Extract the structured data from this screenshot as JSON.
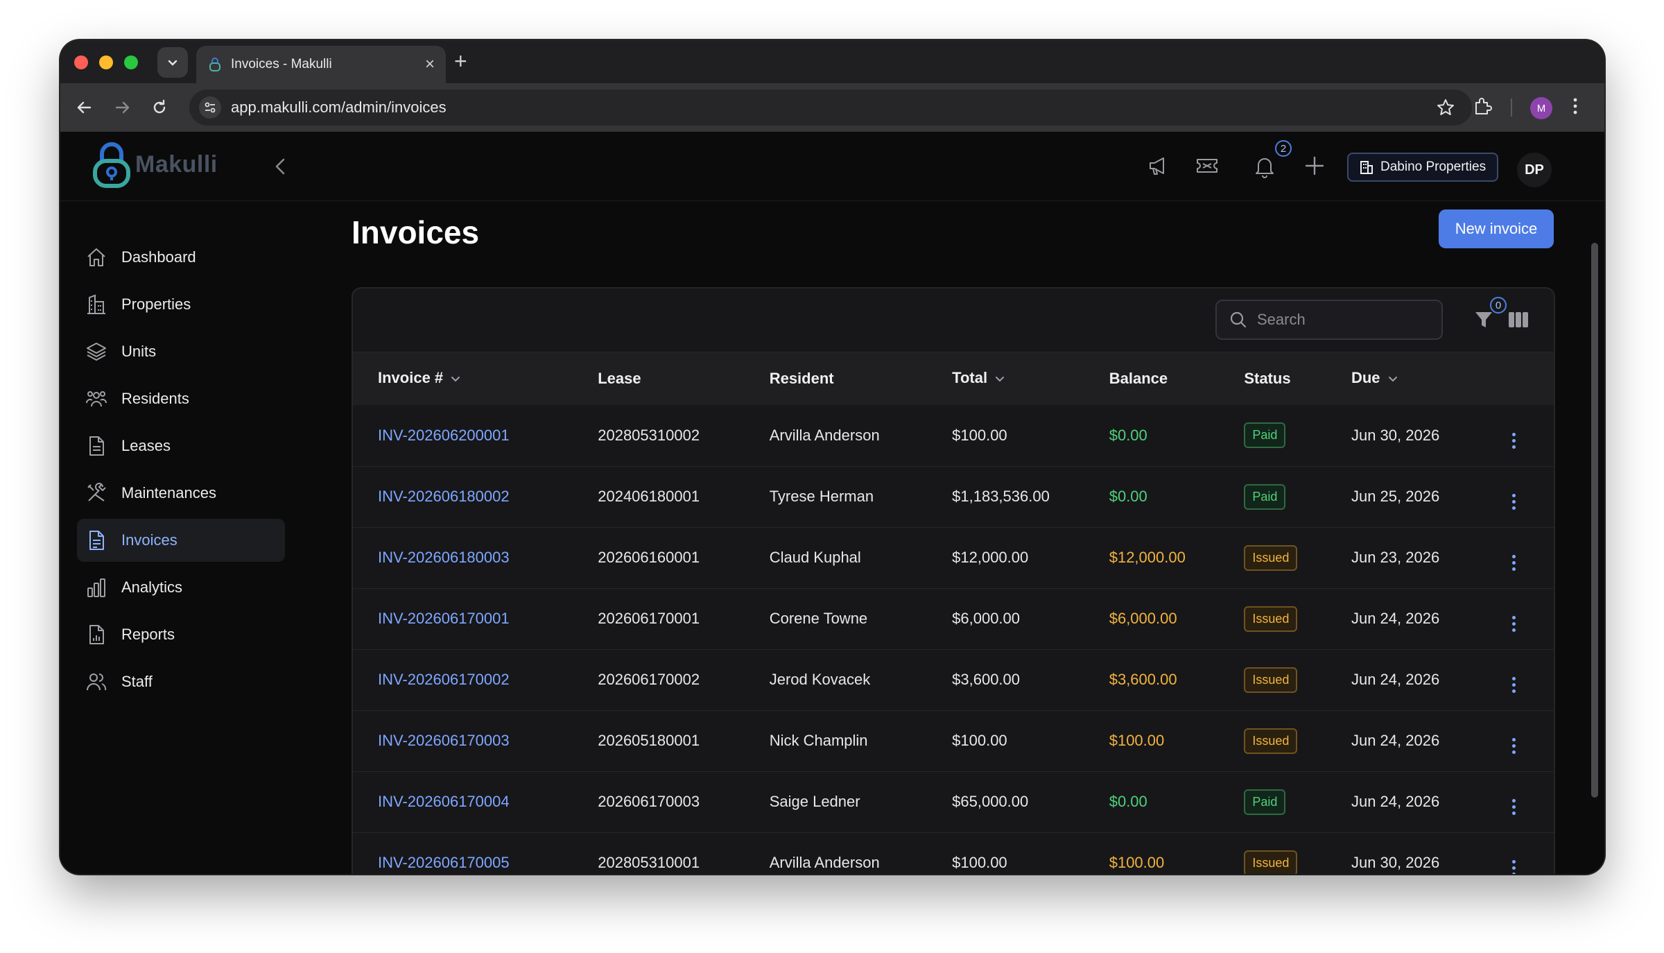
{
  "browser": {
    "tab_title": "Invoices - Makulli",
    "url": "app.makulli.com/admin/invoices",
    "profile_initial": "M"
  },
  "app": {
    "logo_text": "Makulli",
    "notifications_count": "2",
    "org_name": "Dabino Properties",
    "user_initials": "DP"
  },
  "sidebar": {
    "items": [
      {
        "label": "Dashboard",
        "icon": "home-icon"
      },
      {
        "label": "Properties",
        "icon": "buildings-icon"
      },
      {
        "label": "Units",
        "icon": "layers-icon"
      },
      {
        "label": "Residents",
        "icon": "people-icon"
      },
      {
        "label": "Leases",
        "icon": "document-icon"
      },
      {
        "label": "Maintenances",
        "icon": "tools-icon"
      },
      {
        "label": "Invoices",
        "icon": "invoice-icon",
        "active": true
      },
      {
        "label": "Analytics",
        "icon": "bar-chart-icon"
      },
      {
        "label": "Reports",
        "icon": "report-icon"
      },
      {
        "label": "Staff",
        "icon": "staff-icon"
      }
    ]
  },
  "page": {
    "title": "Invoices",
    "new_button": "New invoice"
  },
  "table": {
    "search_placeholder": "Search",
    "filter_count": "0",
    "columns": [
      "Invoice #",
      "Lease",
      "Resident",
      "Total",
      "Balance",
      "Status",
      "Due"
    ],
    "rows": [
      {
        "invoice": "INV-202606200001",
        "lease": "202805310002",
        "resident": "Arvilla Anderson",
        "total": "$100.00",
        "balance": "$0.00",
        "status": "Paid",
        "due": "Jun 30, 2026"
      },
      {
        "invoice": "INV-202606180002",
        "lease": "202406180001",
        "resident": "Tyrese Herman",
        "total": "$1,183,536.00",
        "balance": "$0.00",
        "status": "Paid",
        "due": "Jun 25, 2026"
      },
      {
        "invoice": "INV-202606180003",
        "lease": "202606160001",
        "resident": "Claud Kuphal",
        "total": "$12,000.00",
        "balance": "$12,000.00",
        "status": "Issued",
        "due": "Jun 23, 2026"
      },
      {
        "invoice": "INV-202606170001",
        "lease": "202606170001",
        "resident": "Corene Towne",
        "total": "$6,000.00",
        "balance": "$6,000.00",
        "status": "Issued",
        "due": "Jun 24, 2026"
      },
      {
        "invoice": "INV-202606170002",
        "lease": "202606170002",
        "resident": "Jerod Kovacek",
        "total": "$3,600.00",
        "balance": "$3,600.00",
        "status": "Issued",
        "due": "Jun 24, 2026"
      },
      {
        "invoice": "INV-202606170003",
        "lease": "202605180001",
        "resident": "Nick Champlin",
        "total": "$100.00",
        "balance": "$100.00",
        "status": "Issued",
        "due": "Jun 24, 2026"
      },
      {
        "invoice": "INV-202606170004",
        "lease": "202606170003",
        "resident": "Saige Ledner",
        "total": "$65,000.00",
        "balance": "$0.00",
        "status": "Paid",
        "due": "Jun 24, 2026"
      },
      {
        "invoice": "INV-202606170005",
        "lease": "202805310001",
        "resident": "Arvilla Anderson",
        "total": "$100.00",
        "balance": "$100.00",
        "status": "Issued",
        "due": "Jun 30, 2026"
      }
    ]
  },
  "colors": {
    "accent": "#4d7ce6",
    "link": "#7fa7ff",
    "paid": "#4fd17a",
    "issued": "#f2b33d"
  }
}
